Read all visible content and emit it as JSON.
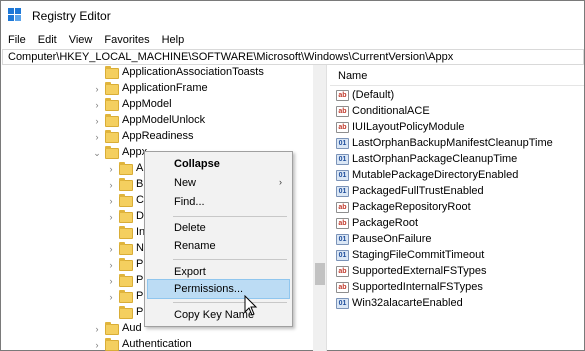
{
  "window": {
    "title": "Registry Editor",
    "app_icon": "regedit-icon",
    "accent": "#1e78d7"
  },
  "menu": [
    "File",
    "Edit",
    "View",
    "Favorites",
    "Help"
  ],
  "address": "Computer\\HKEY_LOCAL_MACHINE\\SOFTWARE\\Microsoft\\Windows\\CurrentVersion\\Appx",
  "tree": {
    "items": [
      {
        "label": "ApplicationAssociationToasts",
        "expander": ""
      },
      {
        "label": "ApplicationFrame",
        "expander": "›"
      },
      {
        "label": "AppModel",
        "expander": "›"
      },
      {
        "label": "AppModelUnlock",
        "expander": "›"
      },
      {
        "label": "AppReadiness",
        "expander": "›"
      },
      {
        "label": "Appx",
        "expander": "⌄"
      },
      {
        "label": "A",
        "expander": "›"
      },
      {
        "label": "B",
        "expander": "›"
      },
      {
        "label": "C",
        "expander": "›"
      },
      {
        "label": "D",
        "expander": "›"
      },
      {
        "label": "In",
        "expander": ""
      },
      {
        "label": "N",
        "expander": "›"
      },
      {
        "label": "P",
        "expander": "›"
      },
      {
        "label": "P",
        "expander": "›"
      },
      {
        "label": "P",
        "expander": "›"
      },
      {
        "label": "P",
        "expander": ""
      },
      {
        "label": "Aud",
        "expander": "›"
      },
      {
        "label": "Authentication",
        "expander": "›"
      }
    ]
  },
  "values": {
    "column_header": "Name",
    "items": [
      {
        "name": "(Default)",
        "type": "sz"
      },
      {
        "name": "ConditionalACE",
        "type": "sz"
      },
      {
        "name": "IUILayoutPolicyModule",
        "type": "sz"
      },
      {
        "name": "LastOrphanBackupManifestCleanupTime",
        "type": "bin"
      },
      {
        "name": "LastOrphanPackageCleanupTime",
        "type": "bin"
      },
      {
        "name": "MutablePackageDirectoryEnabled",
        "type": "bin"
      },
      {
        "name": "PackagedFullTrustEnabled",
        "type": "bin"
      },
      {
        "name": "PackageRepositoryRoot",
        "type": "sz"
      },
      {
        "name": "PackageRoot",
        "type": "sz"
      },
      {
        "name": "PauseOnFailure",
        "type": "bin"
      },
      {
        "name": "StagingFileCommitTimeout",
        "type": "bin"
      },
      {
        "name": "SupportedExternalFSTypes",
        "type": "sz"
      },
      {
        "name": "SupportedInternalFSTypes",
        "type": "sz"
      },
      {
        "name": "Win32alacarteEnabled",
        "type": "bin"
      }
    ]
  },
  "context_menu": {
    "collapse": "Collapse",
    "new": "New",
    "find": "Find...",
    "delete": "Delete",
    "rename": "Rename",
    "export": "Export",
    "permissions": "Permissions...",
    "copy_key_name": "Copy Key Name"
  }
}
